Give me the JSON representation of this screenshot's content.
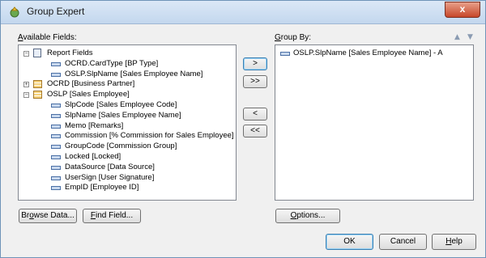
{
  "window": {
    "title": "Group Expert",
    "close_label": "x"
  },
  "available": {
    "label_u": "A",
    "label_rest": "vailable Fields:",
    "tree": [
      {
        "indent": 0,
        "expander": "−",
        "icon": "report",
        "text": "Report Fields"
      },
      {
        "indent": 1,
        "expander": "",
        "icon": "field",
        "text": "OCRD.CardType [BP Type]"
      },
      {
        "indent": 1,
        "expander": "",
        "icon": "field",
        "text": "OSLP.SlpName [Sales Employee Name]"
      },
      {
        "indent": 0,
        "expander": "+",
        "icon": "table",
        "text": "OCRD [Business Partner]"
      },
      {
        "indent": 0,
        "expander": "−",
        "icon": "table",
        "text": "OSLP [Sales Employee]"
      },
      {
        "indent": 1,
        "expander": "",
        "icon": "field",
        "text": "SlpCode [Sales Employee Code]"
      },
      {
        "indent": 1,
        "expander": "",
        "icon": "field",
        "text": "SlpName [Sales Employee Name]"
      },
      {
        "indent": 1,
        "expander": "",
        "icon": "field",
        "text": "Memo [Remarks]"
      },
      {
        "indent": 1,
        "expander": "",
        "icon": "field",
        "text": "Commission [% Commission for Sales Employee]"
      },
      {
        "indent": 1,
        "expander": "",
        "icon": "field",
        "text": "GroupCode [Commission Group]"
      },
      {
        "indent": 1,
        "expander": "",
        "icon": "field",
        "text": "Locked [Locked]"
      },
      {
        "indent": 1,
        "expander": "",
        "icon": "field",
        "text": "DataSource [Data Source]"
      },
      {
        "indent": 1,
        "expander": "",
        "icon": "field",
        "text": "UserSign [User Signature]"
      },
      {
        "indent": 1,
        "expander": "",
        "icon": "field",
        "text": "EmpID [Employee ID]"
      }
    ]
  },
  "transfer": {
    "add_one": ">",
    "add_all": ">>",
    "remove_one": "<",
    "remove_all": "<<"
  },
  "group_by": {
    "label_u": "G",
    "label_rest": "roup By:",
    "up_arrow": "▲",
    "down_arrow": "▼",
    "items": [
      {
        "text": "OSLP.SlpName [Sales Employee Name] - A"
      }
    ]
  },
  "buttons": {
    "browse_u": "o",
    "browse_pre": "Br",
    "browse_post": "wse Data...",
    "find_u": "F",
    "find_post": "ind Field...",
    "options_pre": "O",
    "options_post": "ptions...",
    "ok": "OK",
    "cancel": "Cancel",
    "help_u": "H",
    "help_post": "elp"
  }
}
